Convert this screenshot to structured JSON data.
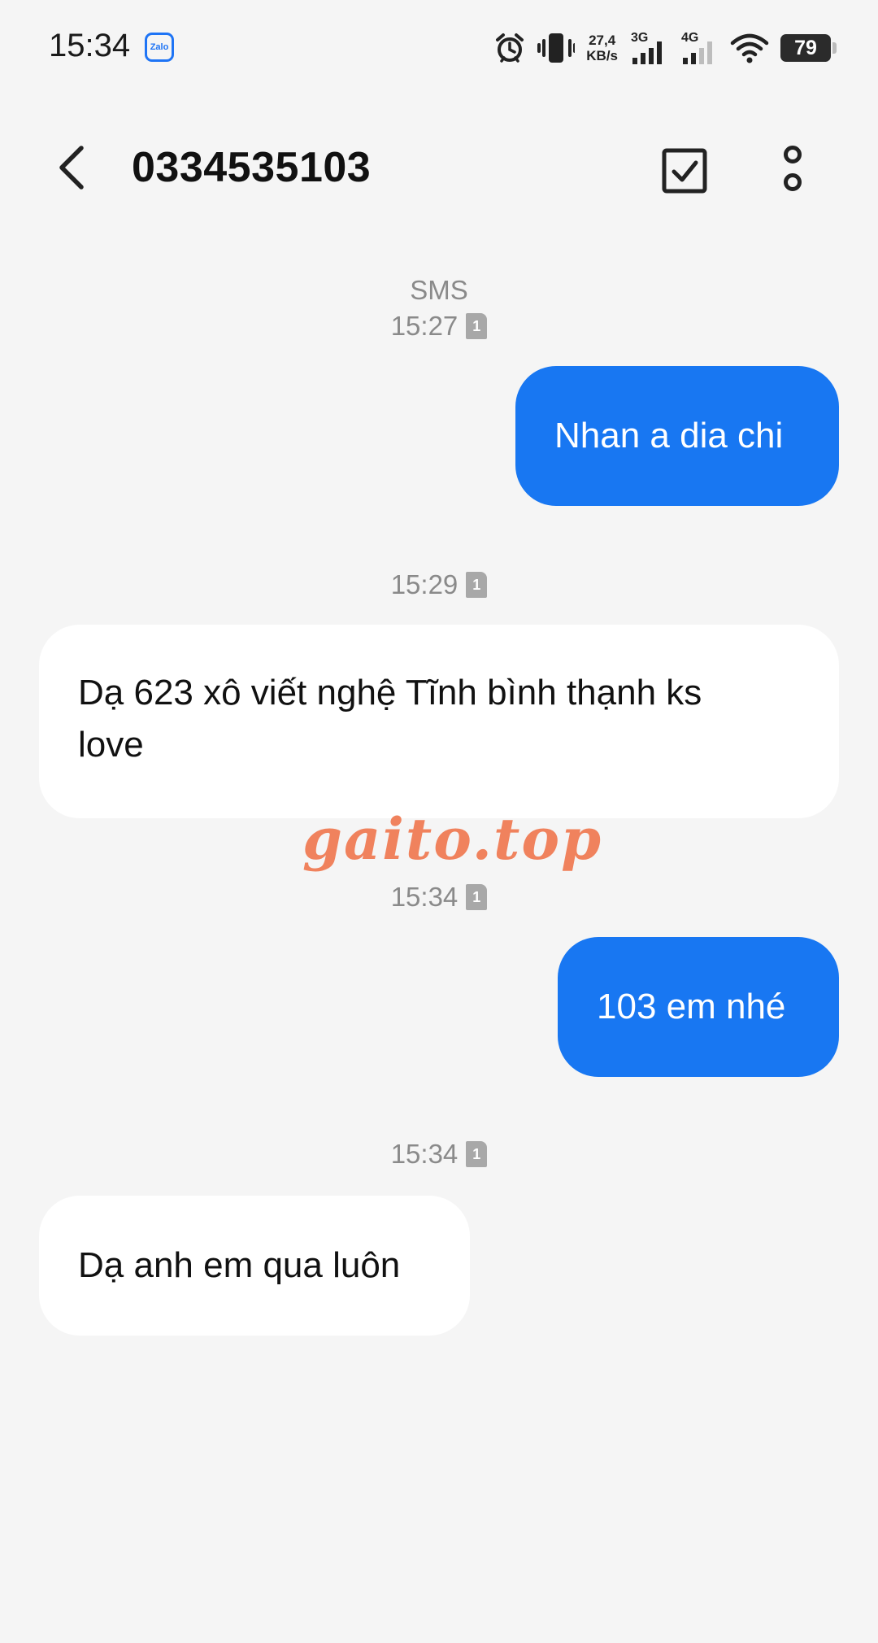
{
  "status_bar": {
    "time": "15:34",
    "zalo_label": "Zalo",
    "speed_value": "27,4",
    "speed_unit": "KB/s",
    "network_1": "3G",
    "network_2": "4G",
    "battery": "79"
  },
  "header": {
    "title": "0334535103",
    "back_icon": "chevron-left-icon",
    "select_icon": "checkbox-icon",
    "more_icon": "more-vertical-icon"
  },
  "conversation": {
    "channel_label": "SMS",
    "sim_label": "1",
    "timestamps": [
      "15:27",
      "15:29",
      "15:34",
      "15:34"
    ],
    "messages": [
      {
        "direction": "outgoing",
        "text": "Nhan a dia chi"
      },
      {
        "direction": "incoming",
        "text": "Dạ 623 xô viết nghệ Tĩnh bình thạnh ks love"
      },
      {
        "direction": "outgoing",
        "text": "103 em nhé"
      },
      {
        "direction": "incoming",
        "text": "Dạ anh em qua luôn"
      }
    ]
  },
  "watermark": {
    "text": "gaito.top"
  },
  "colors": {
    "background": "#f5f5f5",
    "outgoing_bubble": "#1877f2",
    "incoming_bubble": "#ffffff",
    "meta_text": "#8a8a8a",
    "watermark": "#f07c55"
  }
}
